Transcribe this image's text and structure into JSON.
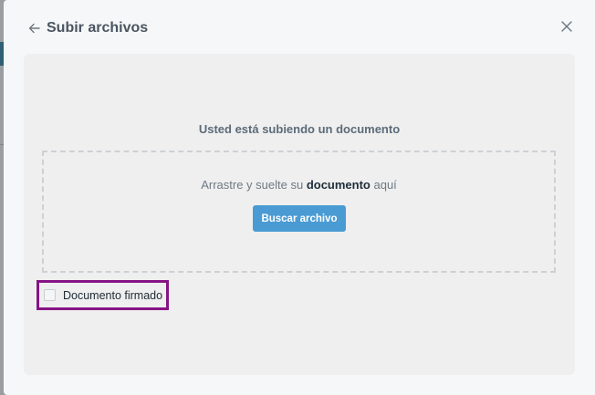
{
  "modal": {
    "title": "Subir archivos"
  },
  "upload": {
    "heading": "Usted está subiendo un documento",
    "drop_prefix": "Arrastre y suelte su ",
    "drop_bold": "documento",
    "drop_suffix": " aquí",
    "browse_label": "Buscar archivo"
  },
  "options": {
    "signed_label": "Documento firmado",
    "signed_checked": false
  },
  "colors": {
    "accent": "#4a9bd3",
    "highlight_border": "#861486",
    "title_text": "#4a5560"
  },
  "icons": {
    "back": "arrow-left-icon",
    "close": "close-icon"
  }
}
